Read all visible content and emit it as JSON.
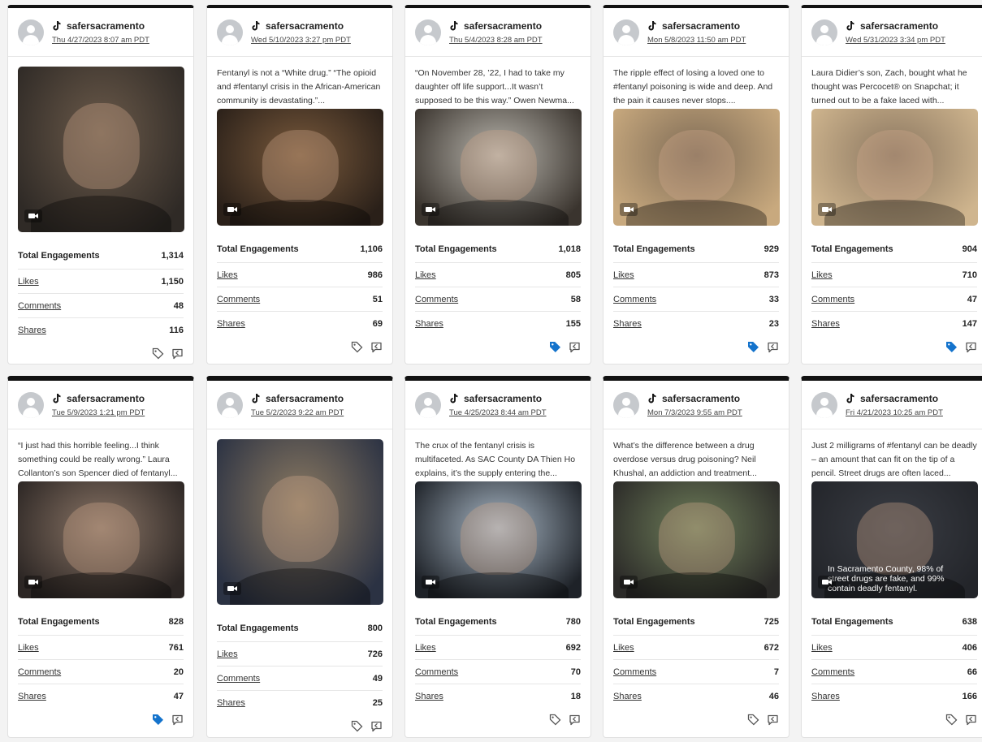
{
  "labels": {
    "total": "Total Engagements",
    "likes": "Likes",
    "comments": "Comments",
    "shares": "Shares"
  },
  "colors": {
    "tag_active": "#1473cc",
    "tag_inactive": "#555555",
    "header_border": "#111111"
  },
  "posts": [
    {
      "user": "safersacramento",
      "date": "Thu 4/27/2023 8:07 am PDT",
      "caption": "",
      "total": "1,314",
      "likes": "1,150",
      "comments": "48",
      "shares": "116",
      "tagged": false,
      "bg": [
        "#6b5a4a",
        "#2f2a26"
      ]
    },
    {
      "user": "safersacramento",
      "date": "Wed 5/10/2023 3:27 pm PDT",
      "caption": "Fentanyl is not a “White drug.” “The opioid and #fentanyl crisis in the African-American community is devastating.”...",
      "total": "1,106",
      "likes": "986",
      "comments": "51",
      "shares": "69",
      "tagged": false,
      "bg": [
        "#7a5a3c",
        "#2a2019"
      ]
    },
    {
      "user": "safersacramento",
      "date": "Thu 5/4/2023 8:28 am PDT",
      "caption": "“On November 28, ’22, I had to take my daughter off life support...It wasn’t supposed to be this way.” Owen Newma...",
      "total": "1,018",
      "likes": "805",
      "comments": "58",
      "shares": "155",
      "tagged": true,
      "bg": [
        "#b9b6ae",
        "#3a342e"
      ]
    },
    {
      "user": "safersacramento",
      "date": "Mon 5/8/2023 11:50 am PDT",
      "caption": "The ripple effect of losing a loved one to #fentanyl poisoning is wide and deep. And the pain it causes never stops....",
      "total": "929",
      "likes": "873",
      "comments": "33",
      "shares": "23",
      "tagged": true,
      "bg": [
        "#7d6a55",
        "#c8a97e"
      ]
    },
    {
      "user": "safersacramento",
      "date": "Wed 5/31/2023 3:34 pm PDT",
      "caption": "Laura Didier’s son, Zach, bought what he thought was Percocet® on Snapchat; it turned out to be a fake laced with...",
      "total": "904",
      "likes": "710",
      "comments": "47",
      "shares": "147",
      "tagged": true,
      "bg": [
        "#8a7660",
        "#cfb58e"
      ]
    },
    {
      "user": "safersacramento",
      "date": "Tue 5/9/2023 1:21 pm PDT",
      "caption": "“I just had this horrible feeling...I think something could be really wrong.” Laura Collanton’s son Spencer died of fentanyl...",
      "total": "828",
      "likes": "761",
      "comments": "20",
      "shares": "47",
      "tagged": true,
      "bg": [
        "#8a7566",
        "#2c2624"
      ]
    },
    {
      "user": "safersacramento",
      "date": "Tue 5/2/2023 9:22 am PDT",
      "caption": "",
      "total": "800",
      "likes": "726",
      "comments": "49",
      "shares": "25",
      "tagged": false,
      "bg": [
        "#8d7b62",
        "#2b3243"
      ]
    },
    {
      "user": "safersacramento",
      "date": "Tue 4/25/2023 8:44 am PDT",
      "caption": "The crux of the fentanyl crisis is multifaceted. As SAC County DA Thien Ho explains, it’s the supply entering the...",
      "total": "780",
      "likes": "692",
      "comments": "70",
      "shares": "18",
      "tagged": false,
      "bg": [
        "#a9b8c6",
        "#1e2228"
      ]
    },
    {
      "user": "safersacramento",
      "date": "Mon 7/3/2023 9:55 am PDT",
      "caption": "What’s the difference between a drug overdose versus drug poisoning? Neil Khushal, an addiction and treatment...",
      "total": "725",
      "likes": "672",
      "comments": "7",
      "shares": "46",
      "tagged": false,
      "bg": [
        "#6f7f5a",
        "#2b2a28"
      ]
    },
    {
      "user": "safersacramento",
      "date": "Fri 4/21/2023 10:25 am PDT",
      "caption": "Just 2 milligrams of #fentanyl can be deadly – an amount that can fit on the tip of a pencil. Street drugs are often laced...",
      "total": "638",
      "likes": "406",
      "comments": "66",
      "shares": "166",
      "tagged": false,
      "bg": [
        "#3a3d44",
        "#23252a"
      ],
      "overlay": "In Sacramento County, 98% of street drugs are fake, and 99% contain deadly fentanyl."
    }
  ]
}
